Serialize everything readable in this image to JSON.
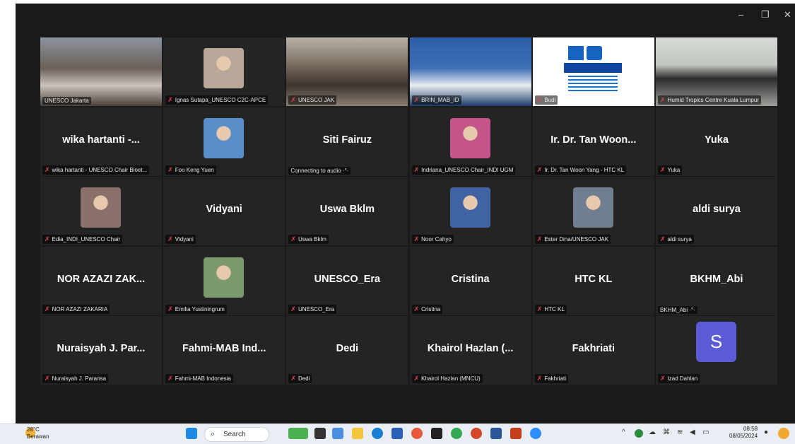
{
  "window": {
    "minimize": "–",
    "restore": "❐",
    "close": "✕"
  },
  "tiles": [
    {
      "caption": "UNESCO Jakarta",
      "muted": false,
      "kind": "video",
      "scene": "hall"
    },
    {
      "caption": "Ignas Sutapa_UNESCO C2C-APCE",
      "muted": true,
      "kind": "photo",
      "tone": "#b7a89a"
    },
    {
      "caption": "UNESCO JAK",
      "muted": true,
      "kind": "video",
      "scene": "room"
    },
    {
      "caption": "BRIN_MAB_ID",
      "muted": true,
      "kind": "video",
      "scene": "banner"
    },
    {
      "caption": "Budi",
      "muted": true,
      "kind": "video",
      "scene": "unesco"
    },
    {
      "caption": "Humid Tropics Centre Kuala Lumpur",
      "muted": true,
      "kind": "video",
      "scene": "office"
    },
    {
      "caption": "wika hartanti - UNESCO Chair Bioet...",
      "muted": true,
      "kind": "name",
      "name": "wika hartanti -..."
    },
    {
      "caption": "Foo Keng Yuen",
      "muted": true,
      "kind": "photo",
      "tone": "#5a8ec8"
    },
    {
      "caption": "Connecting to audio ·°·",
      "muted": false,
      "kind": "name",
      "name": "Siti Fairuz"
    },
    {
      "caption": "Indriana_UNESCO Chair_INDI UGM",
      "muted": true,
      "kind": "photo",
      "tone": "#c4558a"
    },
    {
      "caption": "Ir. Dr. Tan Woon Yang - HTC KL",
      "muted": true,
      "kind": "name",
      "name": "Ir. Dr. Tan Woon..."
    },
    {
      "caption": "Yuka",
      "muted": true,
      "kind": "name",
      "name": "Yuka"
    },
    {
      "caption": "Edia_INDI_UNESCO Chair",
      "muted": true,
      "kind": "photo",
      "tone": "#8a6f6a"
    },
    {
      "caption": "Vidyani",
      "muted": true,
      "kind": "name",
      "name": "Vidyani"
    },
    {
      "caption": "Uswa Bklm",
      "muted": true,
      "kind": "name",
      "name": "Uswa Bklm"
    },
    {
      "caption": "Noor Cahyo",
      "muted": true,
      "kind": "photo",
      "tone": "#3f63a3"
    },
    {
      "caption": "Ester Dina/UNESCO JAK",
      "muted": true,
      "kind": "photo",
      "tone": "#6f7f8f"
    },
    {
      "caption": "aldi surya",
      "muted": true,
      "kind": "name",
      "name": "aldi surya"
    },
    {
      "caption": "NOR AZAZI ZAKARIA",
      "muted": true,
      "kind": "name",
      "name": "NOR AZAZI ZAK..."
    },
    {
      "caption": "Emilia Yustiningrum",
      "muted": true,
      "kind": "photo",
      "tone": "#7d9a6e"
    },
    {
      "caption": "UNESCO_Era",
      "muted": true,
      "kind": "name",
      "name": "UNESCO_Era"
    },
    {
      "caption": "Cristina",
      "muted": true,
      "kind": "name",
      "name": "Cristina"
    },
    {
      "caption": "HTC KL",
      "muted": true,
      "kind": "name",
      "name": "HTC KL"
    },
    {
      "caption": "BKHM_Abi ·°·",
      "muted": false,
      "kind": "name",
      "name": "BKHM_Abi"
    },
    {
      "caption": "Nuraisyah J. Paransa",
      "muted": true,
      "kind": "name",
      "name": "Nuraisyah J. Par..."
    },
    {
      "caption": "Fahmi-MAB Indonesia",
      "muted": true,
      "kind": "name",
      "name": "Fahmi-MAB Ind..."
    },
    {
      "caption": "Dedi",
      "muted": true,
      "kind": "name",
      "name": "Dedi"
    },
    {
      "caption": "Khairol Hazlan (MNCU)",
      "muted": true,
      "kind": "name",
      "name": "Khairol Hazlan (..."
    },
    {
      "caption": "Fakhriati",
      "muted": true,
      "kind": "name",
      "name": "Fakhriati"
    },
    {
      "caption": "Izad Dahlan",
      "muted": true,
      "kind": "avatar",
      "letter": "S"
    }
  ],
  "taskbar": {
    "temperature": "28°C",
    "weather": "Berawan",
    "search_label": "Search",
    "time": "08:58",
    "date": "08/05/2024"
  }
}
